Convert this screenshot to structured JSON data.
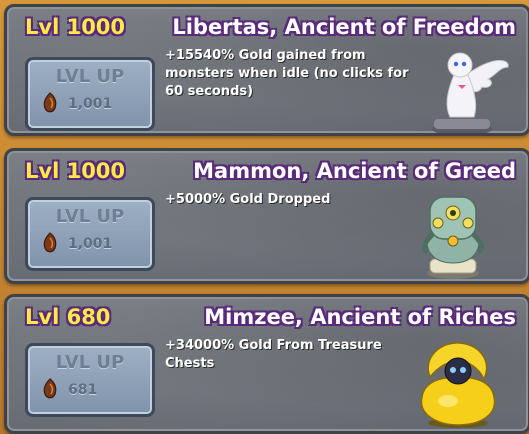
{
  "ancients": [
    {
      "level": "Lvl 1000",
      "name": "Libertas, Ancient of Freedom",
      "description": "+15540% Gold gained from monsters when idle (no clicks for 60 seconds)",
      "button_label": "LVL UP",
      "cost": "1,001",
      "portrait_icon": "libertas-statue-icon"
    },
    {
      "level": "Lvl 1000",
      "name": "Mammon, Ancient of Greed",
      "description": "+5000% Gold Dropped",
      "button_label": "LVL UP",
      "cost": "1,001",
      "portrait_icon": "mammon-statue-icon"
    },
    {
      "level": "Lvl 680",
      "name": "Mimzee, Ancient of Riches",
      "description": "+34000% Gold From Treasure Chests",
      "button_label": "LVL UP",
      "cost": "681",
      "portrait_icon": "mimzee-statue-icon"
    }
  ],
  "colors": {
    "level_text": "#ffe94a",
    "outline": "#5a2a7a",
    "card_bg": "#74787f",
    "button_bg": "#8fa2b8",
    "background": "#c98a2b"
  }
}
